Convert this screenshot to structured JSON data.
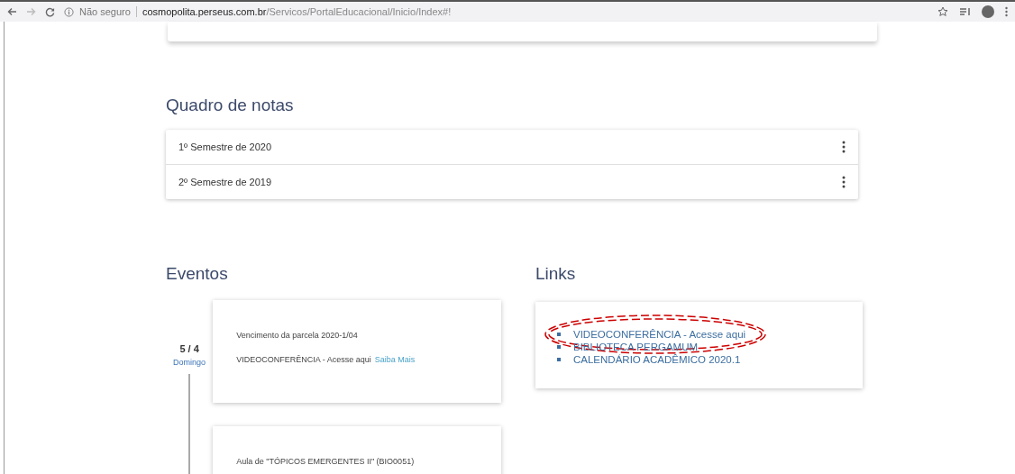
{
  "browser": {
    "security": "Não seguro",
    "url_host": "cosmopolita.perseus.com.br",
    "url_path": "/Servicos/PortalEducacional/Inicio/Index#!"
  },
  "grades": {
    "title": "Quadro de notas",
    "rows": [
      {
        "label": "1º Semestre de 2020"
      },
      {
        "label": "2º Semestre de 2019"
      }
    ]
  },
  "events": {
    "title": "Eventos",
    "days": [
      {
        "date": "5 / 4",
        "weekday": "Domingo",
        "lines": [
          "Vencimento da parcela 2020-1/04",
          "VIDEOCONFERÊNCIA - Acesse aqui"
        ],
        "link": "Saiba Mais"
      },
      {
        "lines": [
          "Aula de \"TÓPICOS EMERGENTES II\" (BIO0051)"
        ]
      }
    ]
  },
  "links": {
    "title": "Links",
    "items": [
      {
        "label": "VIDEOCONFERÊNCIA - Acesse aqui",
        "circled": true
      },
      {
        "label": "BIBLIOTECA PERGAMUM",
        "circled": false
      },
      {
        "label": "CALENDÁRIO ACADÊMICO 2020.1",
        "circled": false
      }
    ]
  }
}
